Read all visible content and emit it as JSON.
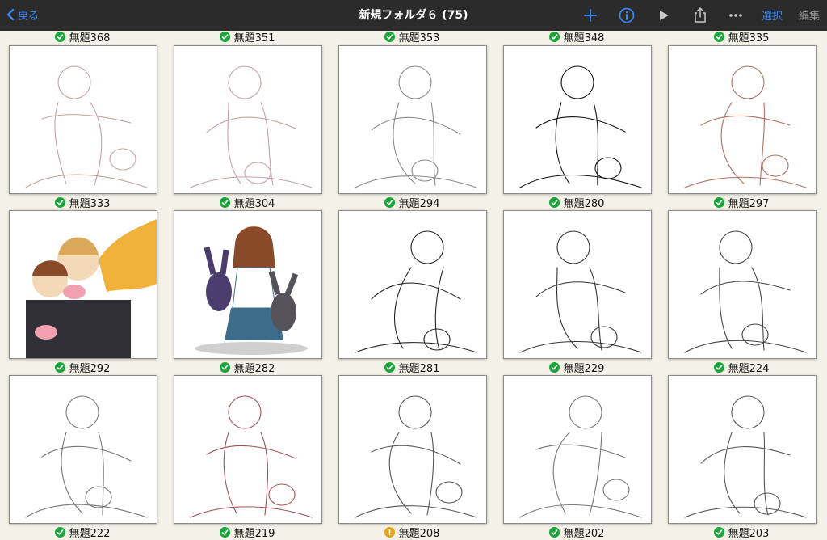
{
  "topbar": {
    "back_label": "戻る",
    "title": "新規フォルダ６ (75)",
    "select_label": "選択",
    "edit_label": "編集",
    "accent_color": "#3a8cff",
    "icons": [
      "plus-icon",
      "info-icon",
      "play-icon",
      "share-icon",
      "more-icon"
    ]
  },
  "top_captions": [
    {
      "label": "無題368",
      "status": "synced"
    },
    {
      "label": "無題351",
      "status": "synced"
    },
    {
      "label": "無題353",
      "status": "synced"
    },
    {
      "label": "無題348",
      "status": "synced"
    },
    {
      "label": "無題335",
      "status": "synced"
    }
  ],
  "rows": [
    [
      {
        "label": "無題333",
        "status": "synced"
      },
      {
        "label": "無題304",
        "status": "synced"
      },
      {
        "label": "無題294",
        "status": "synced"
      },
      {
        "label": "無題280",
        "status": "synced"
      },
      {
        "label": "無題297",
        "status": "synced"
      }
    ],
    [
      {
        "label": "無題292",
        "status": "synced"
      },
      {
        "label": "無題282",
        "status": "synced"
      },
      {
        "label": "無題281",
        "status": "synced"
      },
      {
        "label": "無題229",
        "status": "synced"
      },
      {
        "label": "無題224",
        "status": "synced"
      }
    ],
    [
      {
        "label": "無題222",
        "status": "synced"
      },
      {
        "label": "無題219",
        "status": "synced"
      },
      {
        "label": "無題208",
        "status": "pending"
      },
      {
        "label": "無題202",
        "status": "synced"
      },
      {
        "label": "無題203",
        "status": "synced"
      }
    ]
  ],
  "status_colors": {
    "synced": "#1aa43a",
    "pending": "#e6a21a"
  }
}
